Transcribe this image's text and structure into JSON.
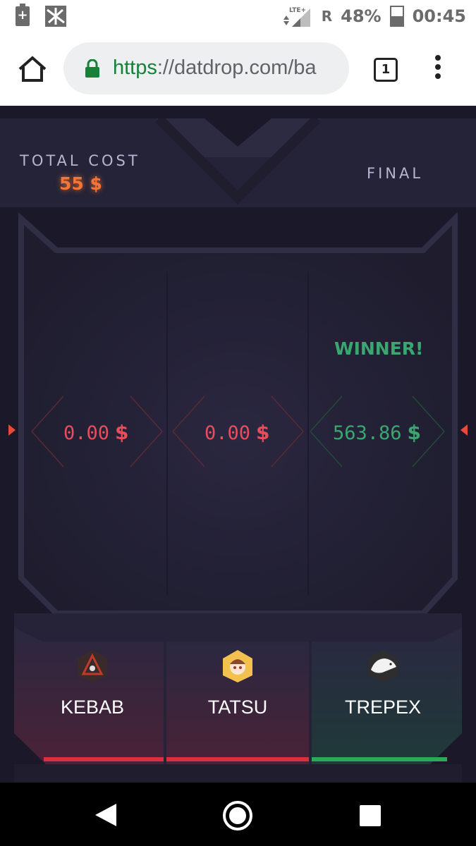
{
  "status_bar": {
    "network": "LTE+",
    "roaming": "R",
    "battery": "48%",
    "time": "00:45"
  },
  "browser": {
    "url_scheme": "https",
    "url_rest": "://datdrop.com/ba",
    "tab_count": "1"
  },
  "battle": {
    "total_cost_label": "TOTAL COST",
    "total_cost_value": "55 $",
    "status_label": "FINAL",
    "winner_label": "WINNER!",
    "currency": "$",
    "players": [
      {
        "name": "KEBAB",
        "amount": "0.00",
        "result": "lose",
        "color": "#e64e5c"
      },
      {
        "name": "TATSU",
        "amount": "0.00",
        "result": "lose",
        "color": "#e64e5c"
      },
      {
        "name": "TREPEX",
        "amount": "563.86",
        "result": "win",
        "color": "#3aa770"
      }
    ]
  }
}
